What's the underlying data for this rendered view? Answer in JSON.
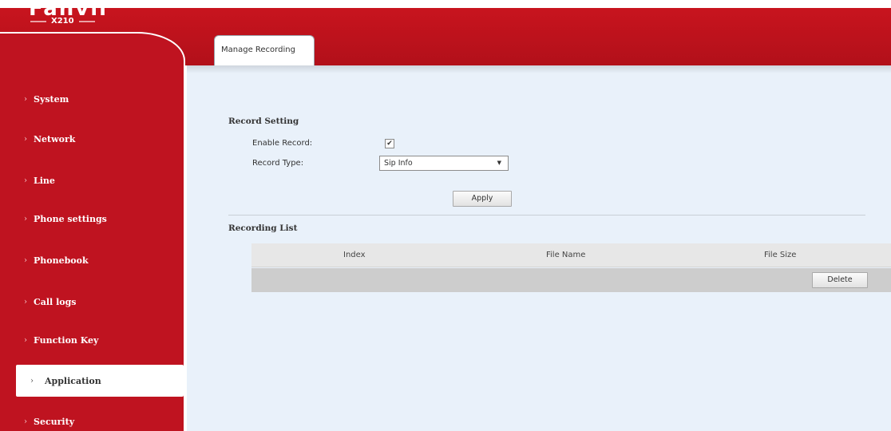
{
  "brand": {
    "logo_word": "Fanvil",
    "model": "X210"
  },
  "sidebar": {
    "items": [
      {
        "label": "System"
      },
      {
        "label": "Network"
      },
      {
        "label": "Line"
      },
      {
        "label": "Phone settings"
      },
      {
        "label": "Phonebook"
      },
      {
        "label": "Call logs"
      },
      {
        "label": "Function Key"
      },
      {
        "label": "Application",
        "active": true
      },
      {
        "label": "Security"
      }
    ],
    "chevron": "›"
  },
  "tabs": [
    {
      "label": "Manage Recording",
      "active": true
    }
  ],
  "record_setting": {
    "title": "Record Setting",
    "enable_label": "Enable Record:",
    "enable_checked": true,
    "type_label": "Record Type:",
    "type_value": "Sip Info",
    "apply_label": "Apply"
  },
  "recording_list": {
    "title": "Recording List",
    "columns": [
      "Index",
      "File Name",
      "File Size"
    ],
    "rows": [],
    "delete_label": "Delete"
  },
  "colors": {
    "brand_red": "#bf1320",
    "content_bg": "#e9f1fa"
  },
  "icons": {
    "checkbox_mark": "✔",
    "select_caret": "▼"
  }
}
